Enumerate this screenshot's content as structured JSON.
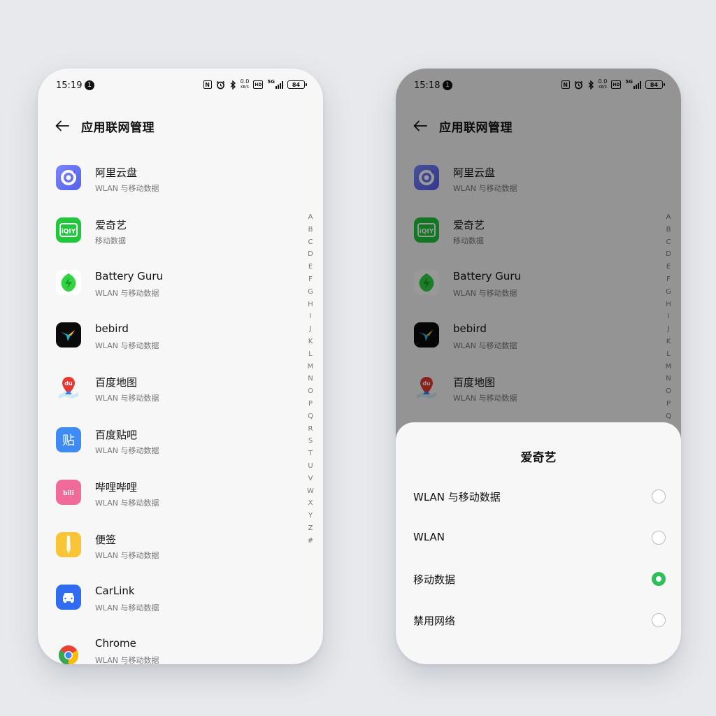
{
  "left_phone": {
    "status": {
      "time": "15:19",
      "notif_count": "1",
      "nfc": "N",
      "net_speed": "0.0",
      "net_unit": "KB/S",
      "hd": "HD",
      "network": "5G",
      "battery": "84"
    },
    "header_title": "应用联网管理",
    "apps": [
      {
        "name": "阿里云盘",
        "sub": "WLAN 与移动数据",
        "icon": "aliyun-drive-icon"
      },
      {
        "name": "爱奇艺",
        "sub": "移动数据",
        "icon": "iqiyi-icon"
      },
      {
        "name": "Battery Guru",
        "sub": "WLAN 与移动数据",
        "icon": "battery-guru-icon"
      },
      {
        "name": "bebird",
        "sub": "WLAN 与移动数据",
        "icon": "bebird-icon"
      },
      {
        "name": "百度地图",
        "sub": "WLAN 与移动数据",
        "icon": "baidu-map-icon"
      },
      {
        "name": "百度贴吧",
        "sub": "WLAN 与移动数据",
        "icon": "baidu-tieba-icon"
      },
      {
        "name": "哔哩哔哩",
        "sub": "WLAN 与移动数据",
        "icon": "bilibili-icon"
      },
      {
        "name": "便签",
        "sub": "WLAN 与移动数据",
        "icon": "notes-icon"
      },
      {
        "name": "CarLink",
        "sub": "WLAN 与移动数据",
        "icon": "carlink-icon"
      },
      {
        "name": "Chrome",
        "sub": "WLAN 与移动数据",
        "icon": "chrome-icon"
      }
    ],
    "alphabet": [
      "A",
      "B",
      "C",
      "D",
      "E",
      "F",
      "G",
      "H",
      "I",
      "J",
      "K",
      "L",
      "M",
      "N",
      "O",
      "P",
      "Q",
      "R",
      "S",
      "T",
      "U",
      "V",
      "W",
      "X",
      "Y",
      "Z",
      "#"
    ]
  },
  "right_phone": {
    "status": {
      "time": "15:18",
      "notif_count": "1",
      "nfc": "N",
      "net_speed": "0.0",
      "net_unit": "KB/S",
      "hd": "HD",
      "network": "5G",
      "battery": "84"
    },
    "header_title": "应用联网管理",
    "apps": [
      {
        "name": "阿里云盘",
        "sub": "WLAN 与移动数据",
        "icon": "aliyun-drive-icon"
      },
      {
        "name": "爱奇艺",
        "sub": "移动数据",
        "icon": "iqiyi-icon"
      },
      {
        "name": "Battery Guru",
        "sub": "WLAN 与移动数据",
        "icon": "battery-guru-icon"
      },
      {
        "name": "bebird",
        "sub": "WLAN 与移动数据",
        "icon": "bebird-icon"
      },
      {
        "name": "百度地图",
        "sub": "WLAN 与移动数据",
        "icon": "baidu-map-icon"
      }
    ],
    "alphabet": [
      "A",
      "B",
      "C",
      "D",
      "E",
      "F",
      "G",
      "H",
      "I",
      "J",
      "K",
      "L",
      "M",
      "N",
      "O",
      "P",
      "Q"
    ],
    "sheet": {
      "title": "爱奇艺",
      "options": [
        {
          "label": "WLAN 与移动数据",
          "selected": false
        },
        {
          "label": "WLAN",
          "selected": false
        },
        {
          "label": "移动数据",
          "selected": true
        },
        {
          "label": "禁用网络",
          "selected": false
        }
      ]
    }
  },
  "colors": {
    "selected_radio": "#2fbf5a",
    "background": "#e7e9ec"
  }
}
